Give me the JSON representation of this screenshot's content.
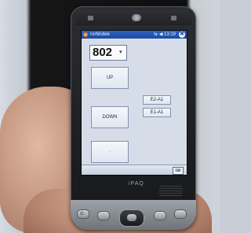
{
  "app": {
    "title": "rorMobile",
    "status": "⇆ ◀ 13:19",
    "close_label": "✖"
  },
  "device": {
    "brand": "iPAQ"
  },
  "form": {
    "selected_value": "802",
    "dropdown_arrow": "▾",
    "buttons": {
      "up": "UP",
      "down": "DOWN",
      "stop": "·",
      "e2": "E2-A1",
      "e1": "E1-A1"
    }
  },
  "menubar": {
    "keyboard_label": "⌨"
  },
  "colors": {
    "titlebar": "#1d4aa0",
    "screen_bg": "#d7dde8"
  }
}
